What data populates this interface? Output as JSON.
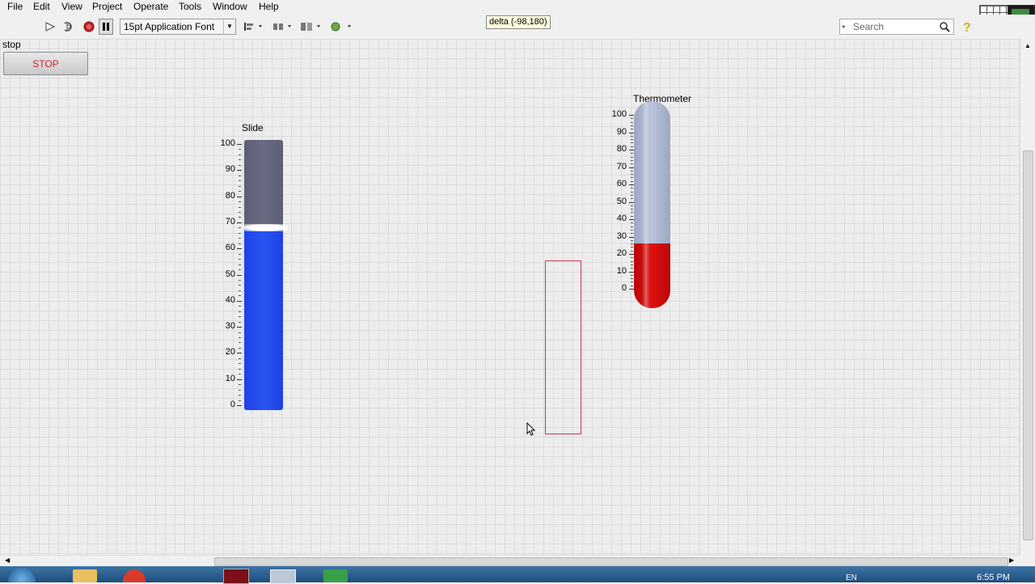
{
  "menu": [
    "File",
    "Edit",
    "View",
    "Project",
    "Operate",
    "Tools",
    "Window",
    "Help"
  ],
  "toolbar": {
    "font": "15pt Application Font",
    "delta": "delta (-98,180)",
    "search_placeholder": "Search"
  },
  "controls": {
    "stop_label": "stop",
    "stop_button": "STOP",
    "slide_label": "Slide",
    "slide_value": 68,
    "slide_ticks": [
      "100",
      "90",
      "80",
      "70",
      "60",
      "50",
      "40",
      "30",
      "20",
      "10",
      "0"
    ],
    "thermo_label": "Thermometer",
    "thermo_value": 26,
    "thermo_ticks": [
      "100",
      "90",
      "80",
      "70",
      "60",
      "50",
      "40",
      "30",
      "20",
      "10",
      "0"
    ]
  },
  "taskbar": {
    "time": "6:55 PM",
    "lang": "EN"
  },
  "colors": {
    "slide_fill": "#1e40e6",
    "slide_empty": "#6a6a82",
    "thermo_fill": "#e01010",
    "thermo_empty": "#b8c2d8"
  }
}
